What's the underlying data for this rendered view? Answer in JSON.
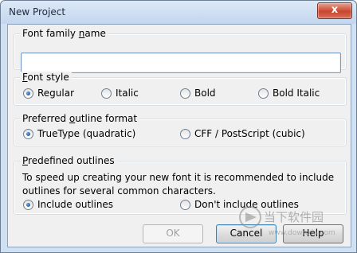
{
  "window": {
    "title": "New Project",
    "close_label": "x"
  },
  "font_family": {
    "legend_pre": "Font family ",
    "legend_ul": "n",
    "legend_post": "ame",
    "value": ""
  },
  "font_style": {
    "legend_ul": "F",
    "legend_post": "ont style",
    "options": [
      "Regular",
      "Italic",
      "Bold",
      "Bold Italic"
    ],
    "selected": "Regular"
  },
  "outline_format": {
    "legend_pre": "Preferred ",
    "legend_ul": "o",
    "legend_post": "utline format",
    "options": [
      "TrueType (quadratic)",
      "CFF / PostScript (cubic)"
    ],
    "selected": "TrueType (quadratic)"
  },
  "predefined": {
    "legend_ul": "P",
    "legend_post": "redefined outlines",
    "description": "To speed up creating your new font it is recommended to include outlines for several common characters.",
    "options": [
      "Include outlines",
      "Don't include outlines"
    ],
    "selected": "Include outlines"
  },
  "buttons": {
    "ok": "OK",
    "cancel": "Cancel",
    "help": "Help"
  },
  "watermark": {
    "text": "当下软件园",
    "url": "www.downxia.com"
  }
}
